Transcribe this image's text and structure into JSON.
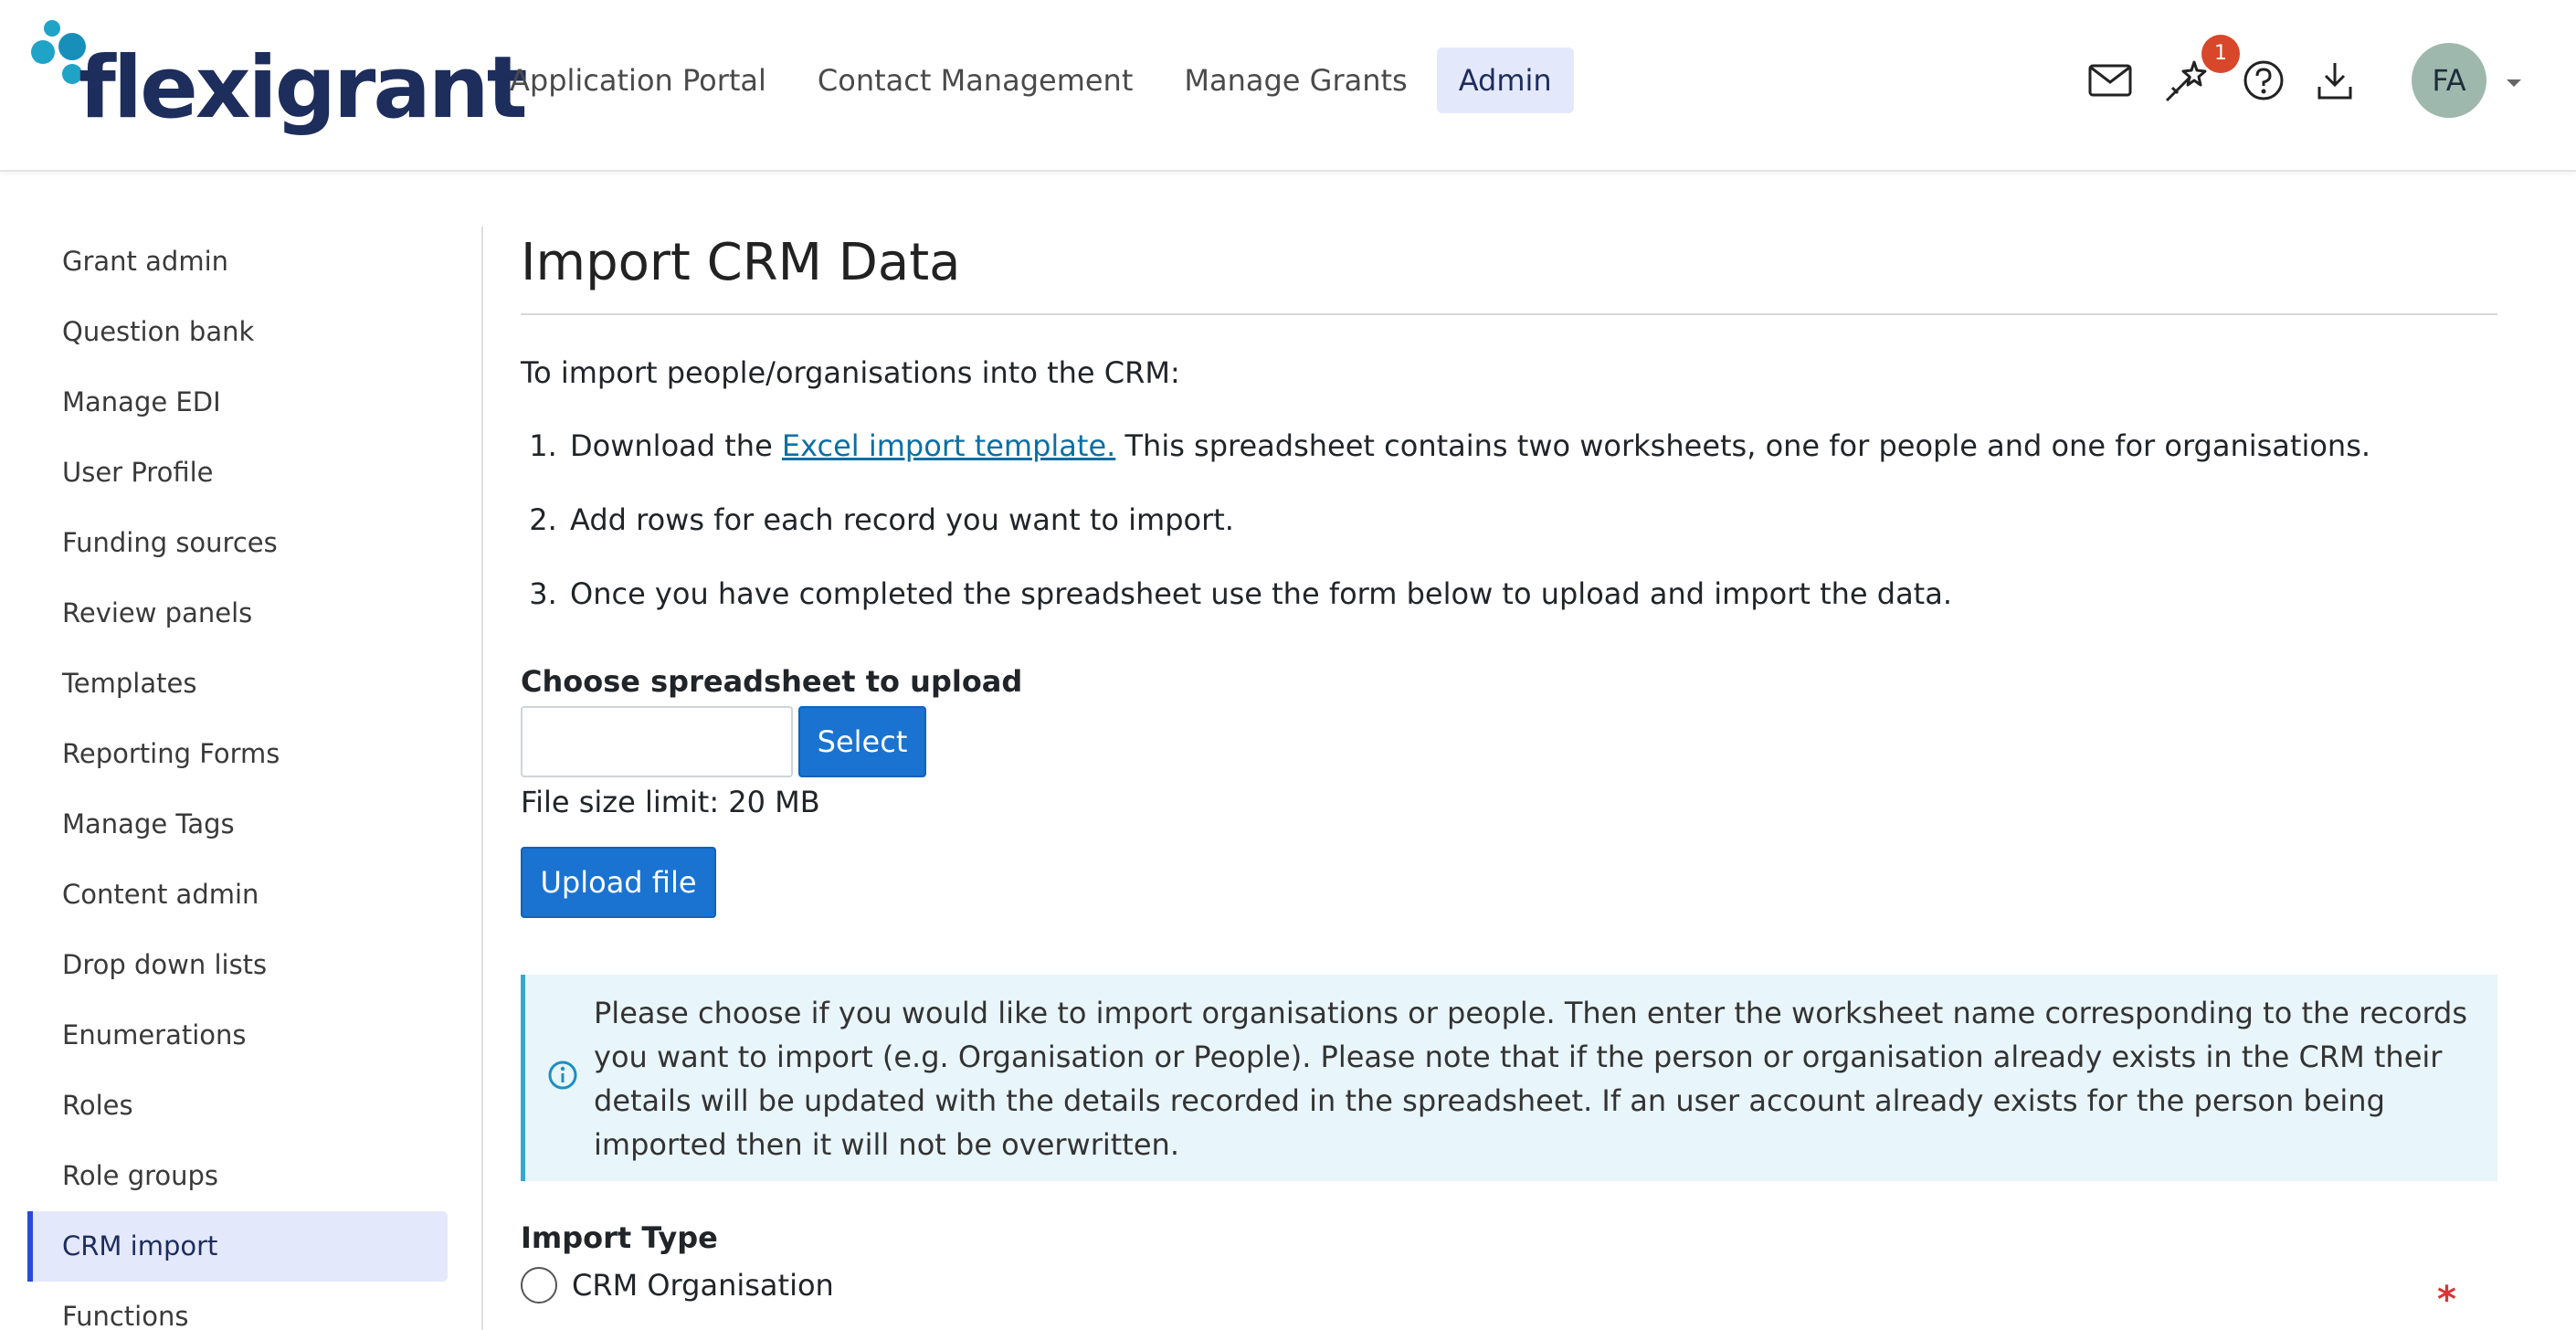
{
  "brand": {
    "name": "flexigrant"
  },
  "nav": [
    {
      "label": "Application Portal"
    },
    {
      "label": "Contact Management"
    },
    {
      "label": "Manage Grants"
    },
    {
      "label": "Admin"
    }
  ],
  "header": {
    "notification_count": "1",
    "avatar_initials": "FA",
    "icons": [
      "mail-icon",
      "magic-wand-icon",
      "help-icon",
      "download-icon"
    ]
  },
  "sidebar": {
    "items": [
      {
        "label": "Grant admin"
      },
      {
        "label": "Question bank"
      },
      {
        "label": "Manage EDI"
      },
      {
        "label": "User Profile"
      },
      {
        "label": "Funding sources"
      },
      {
        "label": "Review panels"
      },
      {
        "label": "Templates"
      },
      {
        "label": "Reporting Forms"
      },
      {
        "label": "Manage Tags"
      },
      {
        "label": "Content admin"
      },
      {
        "label": "Drop down lists"
      },
      {
        "label": "Enumerations"
      },
      {
        "label": "Roles"
      },
      {
        "label": "Role groups"
      },
      {
        "label": "CRM import"
      },
      {
        "label": "Functions"
      }
    ],
    "active": "CRM import"
  },
  "main": {
    "title": "Import CRM Data",
    "intro": "To import people/organisations into the CRM:",
    "step1_prefix": "Download the ",
    "step1_link": "Excel import template.",
    "step1_suffix": " This spreadsheet contains two worksheets, one for people and one for organisations.",
    "step2": "Add rows for each record you want to import.",
    "step3": "Once you have completed the spreadsheet use the form below to upload and import the data.",
    "upload_label": "Choose spreadsheet to upload",
    "file_value": "",
    "select_label": "Select",
    "size_limit": "File size limit: 20 MB",
    "upload_button": "Upload file",
    "info_text": "Please choose if you would like to import organisations or people. Then enter the worksheet name corresponding to the records you want to import (e.g. Organisation or People). Please note that if the person or organisation already exists in the CRM their details will be updated with the details recorded in the spreadsheet. If an user account already exists for the person being imported then it will not be overwritten.",
    "import_type_label": "Import Type",
    "required_mark": "*",
    "options": [
      {
        "label": "CRM Organisation"
      }
    ]
  },
  "colors": {
    "brand": "#1d2d5c",
    "accent": "#1a73d1",
    "info_bg": "#e8f5fa",
    "badge": "#d9472b"
  }
}
